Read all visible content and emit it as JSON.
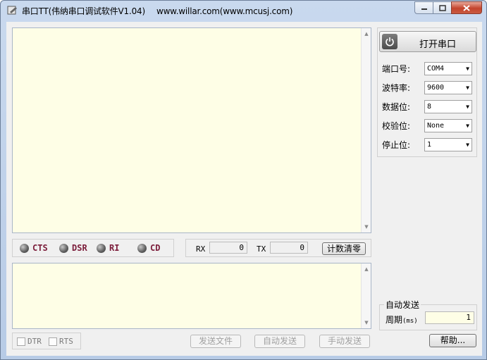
{
  "window": {
    "title": "串口TT(伟纳串口调试软件V1.04)",
    "url": "www.willar.com(www.mcusj.com)"
  },
  "signals": [
    {
      "label": "CTS"
    },
    {
      "label": "DSR"
    },
    {
      "label": "RI"
    },
    {
      "label": "CD"
    }
  ],
  "counters": {
    "rx_label": "RX",
    "rx_value": "0",
    "tx_label": "TX",
    "tx_value": "0",
    "clear_label": "计数清零"
  },
  "controls": {
    "dtr_label": "DTR",
    "rts_label": "RTS",
    "send_file_label": "发送文件",
    "auto_send_label": "自动发送",
    "manual_send_label": "手动发送"
  },
  "port": {
    "open_label": "打开串口",
    "fields": [
      {
        "label": "端口号:",
        "value": "COM4"
      },
      {
        "label": "波特率:",
        "value": "9600"
      },
      {
        "label": "数据位:",
        "value": "8"
      },
      {
        "label": "校验位:",
        "value": "None"
      },
      {
        "label": "停止位:",
        "value": "1"
      }
    ]
  },
  "auto_send": {
    "group_title": "自动发送",
    "period_label": "周期",
    "period_unit": "(ms)",
    "period_value": "1"
  },
  "help_label": "帮助..."
}
